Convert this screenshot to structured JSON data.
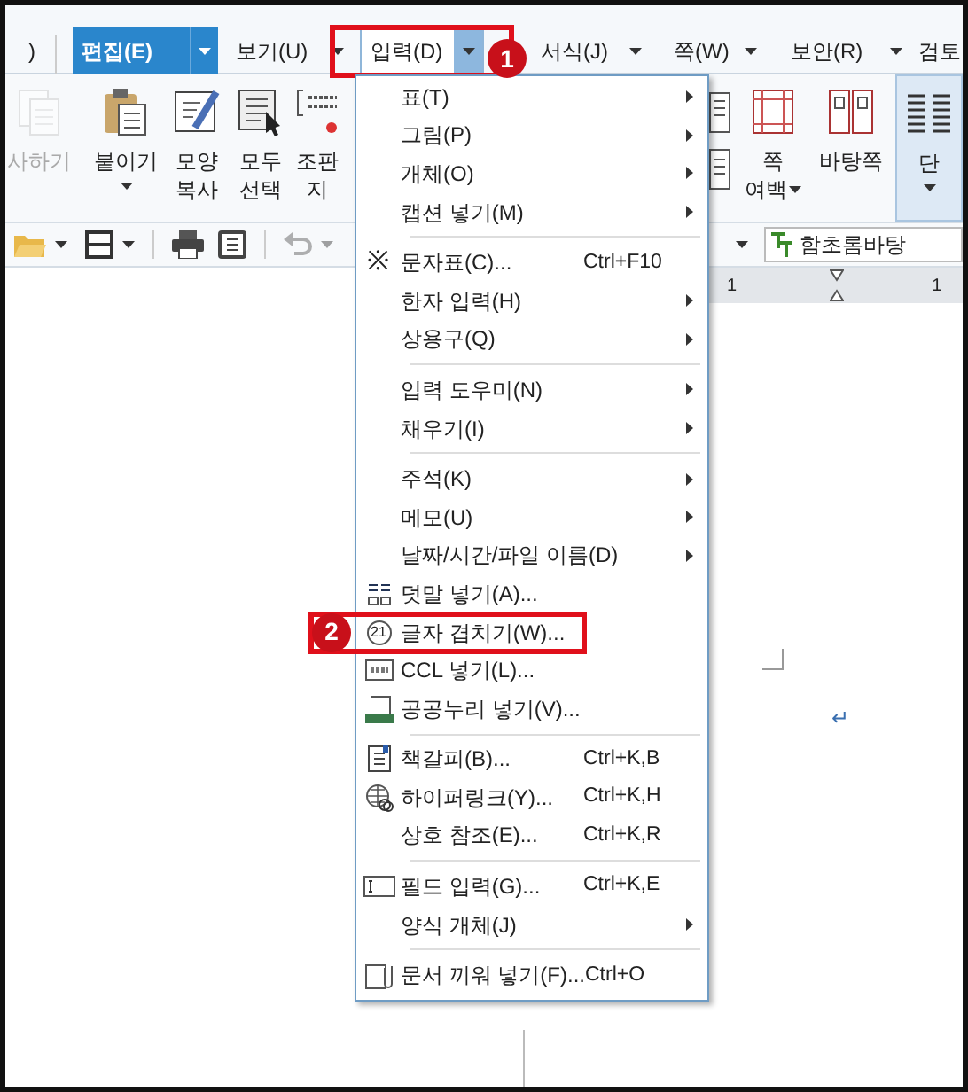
{
  "menu_bar": [
    {
      "label": ")",
      "selected": false,
      "open": false,
      "caret": false,
      "highlighted": false
    },
    {
      "label": "편집(E)",
      "selected": true,
      "open": false,
      "caret": true,
      "highlighted": false
    },
    {
      "label": "보기(U)",
      "selected": false,
      "open": false,
      "caret": true,
      "highlighted": false
    },
    {
      "label": "입력(D)",
      "selected": false,
      "open": true,
      "caret": true,
      "highlighted": true
    },
    {
      "label": "서식(J)",
      "selected": false,
      "open": false,
      "caret": true,
      "highlighted": false
    },
    {
      "label": "쪽(W)",
      "selected": false,
      "open": false,
      "caret": true,
      "highlighted": false
    },
    {
      "label": "보안(R)",
      "selected": false,
      "open": false,
      "caret": true,
      "highlighted": false
    },
    {
      "label": "검토",
      "selected": false,
      "open": false,
      "caret": false,
      "highlighted": false
    }
  ],
  "ribbon_left": [
    {
      "lines": [
        "사하기"
      ],
      "disabled": true,
      "caret": false,
      "selected": false
    },
    {
      "lines": [
        "붙이기"
      ],
      "disabled": false,
      "caret": true,
      "selected": false
    },
    {
      "lines": [
        "모양",
        "복사"
      ],
      "disabled": false,
      "caret": false,
      "selected": false
    },
    {
      "lines": [
        "모두",
        "선택"
      ],
      "disabled": false,
      "caret": false,
      "selected": false
    },
    {
      "lines": [
        "조판",
        "지"
      ],
      "disabled": false,
      "caret": false,
      "selected": false
    }
  ],
  "ribbon_right": [
    {
      "lines": [
        "쪽",
        "여백"
      ],
      "disabled": false,
      "caret": true,
      "selected": false
    },
    {
      "lines": [
        "바탕쪽"
      ],
      "disabled": false,
      "caret": false,
      "selected": false
    },
    {
      "lines": [
        "단"
      ],
      "disabled": false,
      "caret": true,
      "selected": true
    }
  ],
  "toolbar": {
    "font": "함초롬바탕"
  },
  "ruler": [
    "1",
    "1"
  ],
  "document": {
    "return_mark": "↵"
  },
  "dropdown_menu": [
    {
      "label": "표(T)",
      "submenu": true,
      "separator_before": false,
      "highlighted": false
    },
    {
      "label": "그림(P)",
      "submenu": true,
      "separator_before": false,
      "highlighted": false
    },
    {
      "label": "개체(O)",
      "submenu": true,
      "separator_before": false,
      "highlighted": false
    },
    {
      "label": "캡션 넣기(M)",
      "submenu": true,
      "separator_before": false,
      "highlighted": false
    },
    {
      "label": "문자표(C)...",
      "shortcut": "Ctrl+F10",
      "submenu": false,
      "glyph": "※",
      "separator_before": true,
      "highlighted": false
    },
    {
      "label": "한자 입력(H)",
      "submenu": true,
      "separator_before": false,
      "highlighted": false
    },
    {
      "label": "상용구(Q)",
      "submenu": true,
      "separator_before": false,
      "highlighted": false
    },
    {
      "label": "입력 도우미(N)",
      "submenu": true,
      "separator_before": true,
      "highlighted": false
    },
    {
      "label": "채우기(I)",
      "submenu": true,
      "separator_before": false,
      "highlighted": false
    },
    {
      "label": "주석(K)",
      "submenu": true,
      "separator_before": true,
      "highlighted": false
    },
    {
      "label": "메모(U)",
      "submenu": true,
      "separator_before": false,
      "highlighted": false
    },
    {
      "label": "날짜/시간/파일 이름(D)",
      "submenu": true,
      "separator_before": false,
      "highlighted": false
    },
    {
      "label": "덧말 넣기(A)...",
      "submenu": false,
      "separator_before": false,
      "highlighted": false
    },
    {
      "label": "글자 겹치기(W)...",
      "submenu": false,
      "glyph": "21",
      "separator_before": false,
      "highlighted": true
    },
    {
      "label": "CCL 넣기(L)...",
      "submenu": false,
      "separator_before": false,
      "highlighted": false
    },
    {
      "label": "공공누리 넣기(V)...",
      "submenu": false,
      "separator_before": false,
      "highlighted": false
    },
    {
      "label": "책갈피(B)...",
      "shortcut": "Ctrl+K,B",
      "submenu": false,
      "separator_before": true,
      "highlighted": false
    },
    {
      "label": "하이퍼링크(Y)...",
      "shortcut": "Ctrl+K,H",
      "submenu": false,
      "separator_before": false,
      "highlighted": false
    },
    {
      "label": "상호 참조(E)...",
      "shortcut": "Ctrl+K,R",
      "submenu": false,
      "separator_before": false,
      "highlighted": false
    },
    {
      "label": "필드 입력(G)...",
      "shortcut": "Ctrl+K,E",
      "submenu": false,
      "separator_before": true,
      "highlighted": false
    },
    {
      "label": "양식 개체(J)",
      "submenu": true,
      "separator_before": false,
      "highlighted": false
    },
    {
      "label": "문서 끼워 넣기(F)...",
      "shortcut": "Ctrl+O",
      "submenu": false,
      "separator_before": true,
      "highlighted": false
    }
  ],
  "callouts": [
    {
      "number": "1"
    },
    {
      "number": "2"
    }
  ]
}
